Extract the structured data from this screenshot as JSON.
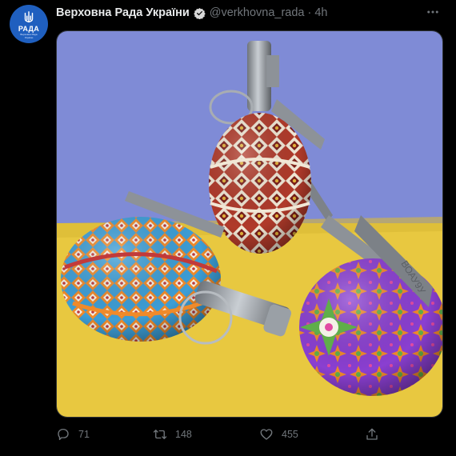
{
  "tweet": {
    "author_name": "Верховна Рада України",
    "handle_time": "@verkhovna_rada · 4h",
    "avatar": {
      "label": "РАДА",
      "subtext": "Верховна Рада України",
      "bg_color": "#1f5fbf"
    },
    "verified_color": "#d9d9d9",
    "media": {
      "background_top": "#7f8bd6",
      "background_bottom": "#e8c840",
      "subject": "painted-grenades-easter-eggs",
      "engraving_text": "ВОАУ9У"
    },
    "actions": {
      "reply_count": "71",
      "retweet_count": "148",
      "like_count": "455"
    },
    "icons": {
      "more": "more-icon",
      "reply": "reply-icon",
      "retweet": "retweet-icon",
      "like": "heart-icon",
      "share": "share-icon",
      "verified": "verified-icon"
    },
    "text_secondary_color": "#71767b"
  }
}
